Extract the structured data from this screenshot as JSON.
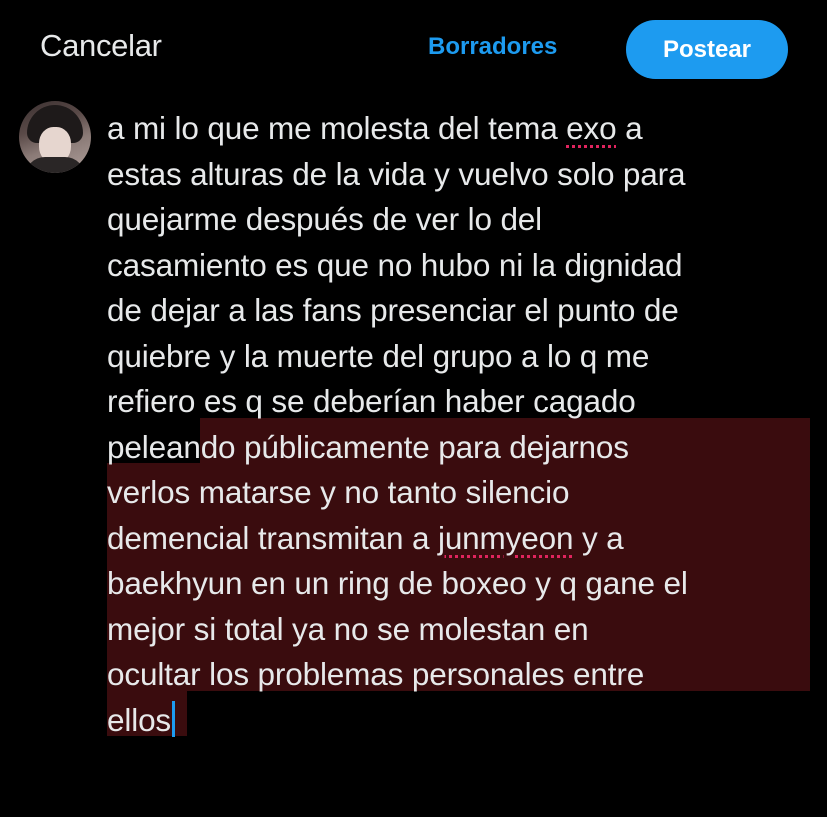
{
  "header": {
    "cancel_label": "Cancelar",
    "drafts_label": "Borradores",
    "post_label": "Postear"
  },
  "composer": {
    "lines": [
      "a mi lo que me molesta del tema ",
      "exo",
      " a",
      "estas alturas de la vida y vuelvo solo para",
      "quejarme después de ver lo del",
      "casamiento es que no hubo ni la dignidad",
      "de dejar a las fans presenciar el punto de",
      "quiebre y la muerte del grupo a lo q me",
      "refiero es q se deberían haber cagado",
      "peleando públicamente para dejarnos",
      "verlos matarse y no tanto silencio",
      "demencial transmitan a ",
      "junmyeon",
      " y a",
      "baekhyun en un ring de boxeo y q gane el",
      "mejor si total ya no se molestan en",
      "ocultar los problemas personales entre",
      "ellos"
    ]
  },
  "colors": {
    "background": "#000000",
    "text": "#e7e9ea",
    "accent": "#1d9bf0",
    "selection": "#3a0c0e",
    "spellcheck": "#e0245e"
  },
  "icons": {
    "avatar": "user-avatar-photo"
  }
}
